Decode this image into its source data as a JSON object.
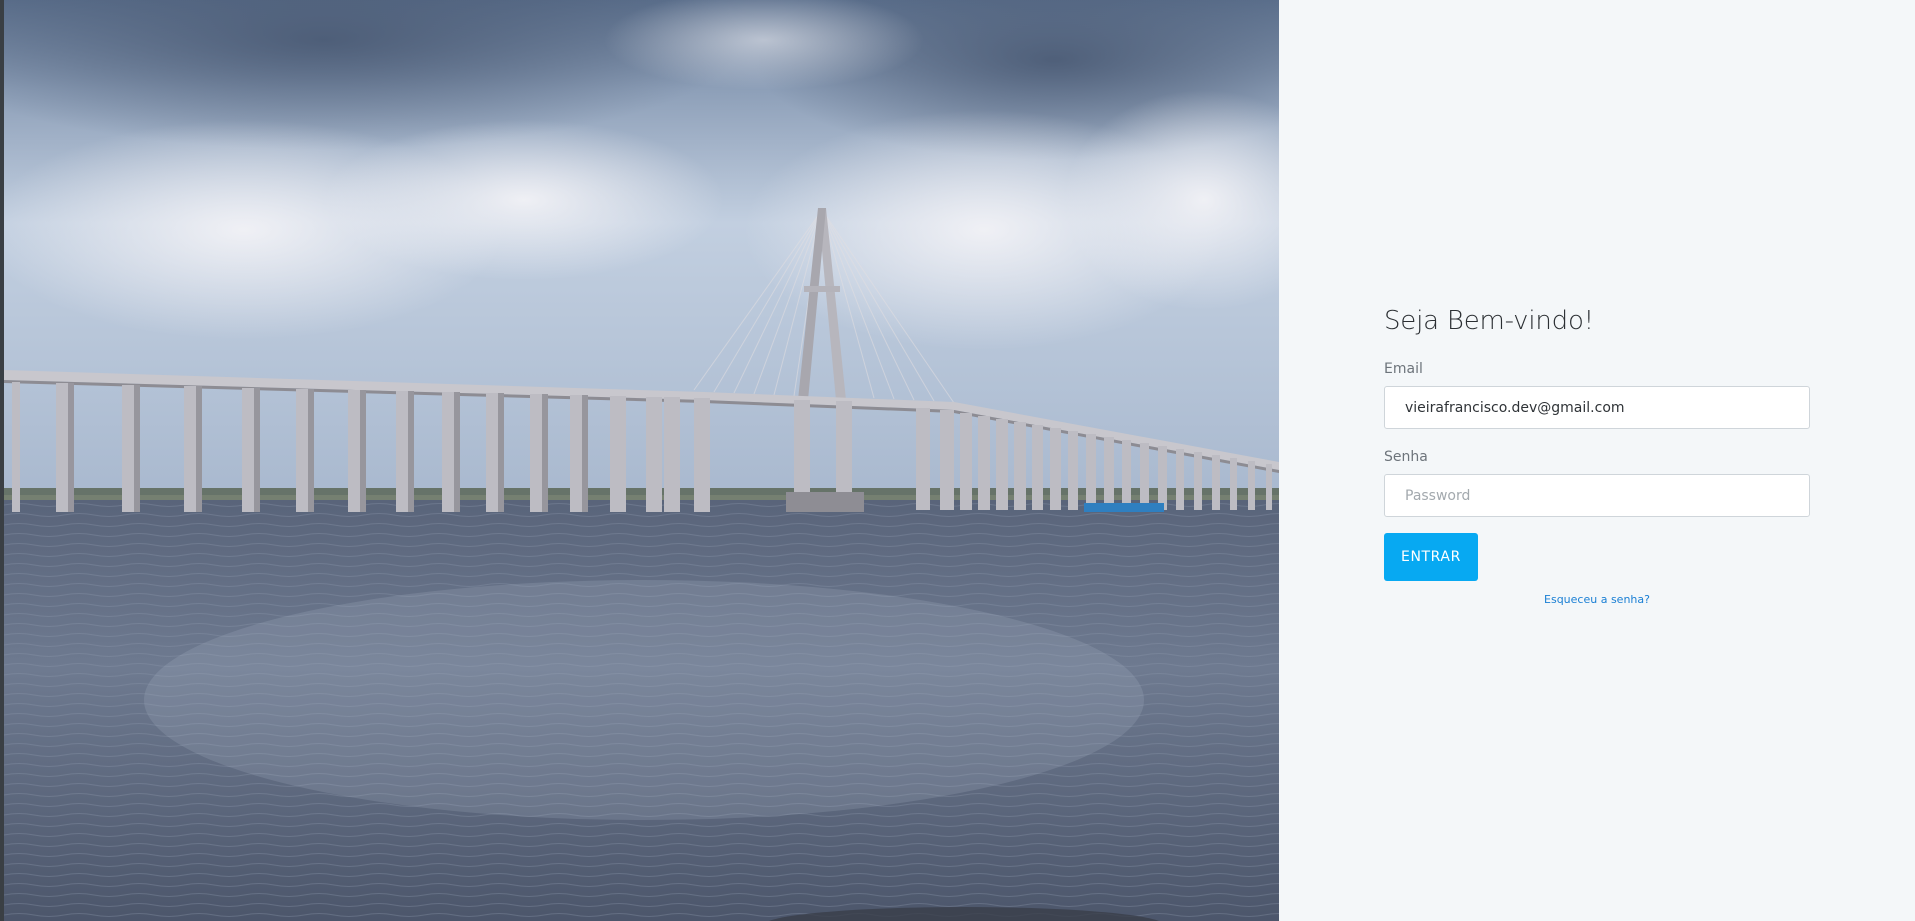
{
  "photo": {
    "description_icon": "bridge-photo",
    "sky_top": "#5f7592",
    "sky_mid": "#b7c6da",
    "water_top": "#4f5a6e",
    "water_bottom": "#6b7689",
    "bridge_color": "#c9c9cf"
  },
  "login": {
    "title": "Seja Bem-vindo!",
    "email_label": "Email",
    "email_value": "vieirafrancisco.dev@gmail.com",
    "password_label": "Senha",
    "password_placeholder": "Password",
    "submit_label": "ENTRAR",
    "forgot_label": "Esqueceu a senha?"
  },
  "colors": {
    "accent": "#07a9f2",
    "link": "#1a7fd4",
    "panel_bg": "#f4f7f9"
  }
}
